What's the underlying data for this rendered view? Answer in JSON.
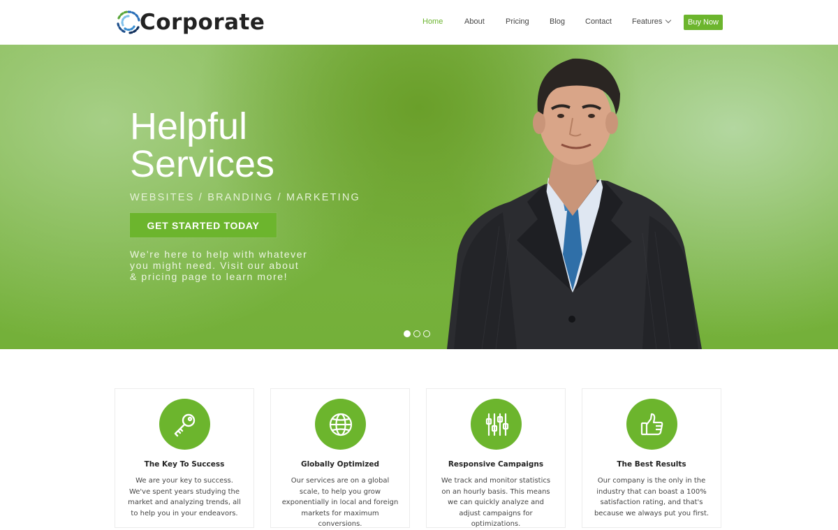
{
  "brand": {
    "name": "Corporate"
  },
  "nav": {
    "items": [
      {
        "label": "Home",
        "active": true
      },
      {
        "label": "About"
      },
      {
        "label": "Pricing"
      },
      {
        "label": "Blog"
      },
      {
        "label": "Contact"
      },
      {
        "label": "Features",
        "has_dropdown": true
      }
    ],
    "buy_label": "Buy Now"
  },
  "hero": {
    "title_line1": "Helpful",
    "title_line2": "Services",
    "subtitle": "WEBSITES / BRANDING / MARKETING",
    "cta_label": "GET STARTED TODAY",
    "text_line1": "We're here to help with whatever",
    "text_line2": "you might need. Visit our about",
    "text_line3": "& pricing page to learn more!",
    "slides": 3,
    "active_slide": 1
  },
  "features": [
    {
      "icon": "key-icon",
      "title": "The Key To Success",
      "text": "We are your key to success. We've spent years studying the market and analyzing trends, all to help you in your endeavors."
    },
    {
      "icon": "globe-icon",
      "title": "Globally Optimized",
      "text": "Our services are on a global scale, to help you grow exponentially in local and foreign markets for maximum conversions."
    },
    {
      "icon": "sliders-icon",
      "title": "Responsive Campaigns",
      "text": "We track and monitor statistics on an hourly basis. This means we can quickly analyze and adjust campaigns for optimizations."
    },
    {
      "icon": "thumbs-up-icon",
      "title": "The Best Results",
      "text": "Our company is the only in the industry that can boast a 100% satisfaction rating, and that's because we always put you first."
    }
  ],
  "colors": {
    "accent": "#6cb52d",
    "hero_green": "#78b23f",
    "text_dark": "#222222"
  }
}
